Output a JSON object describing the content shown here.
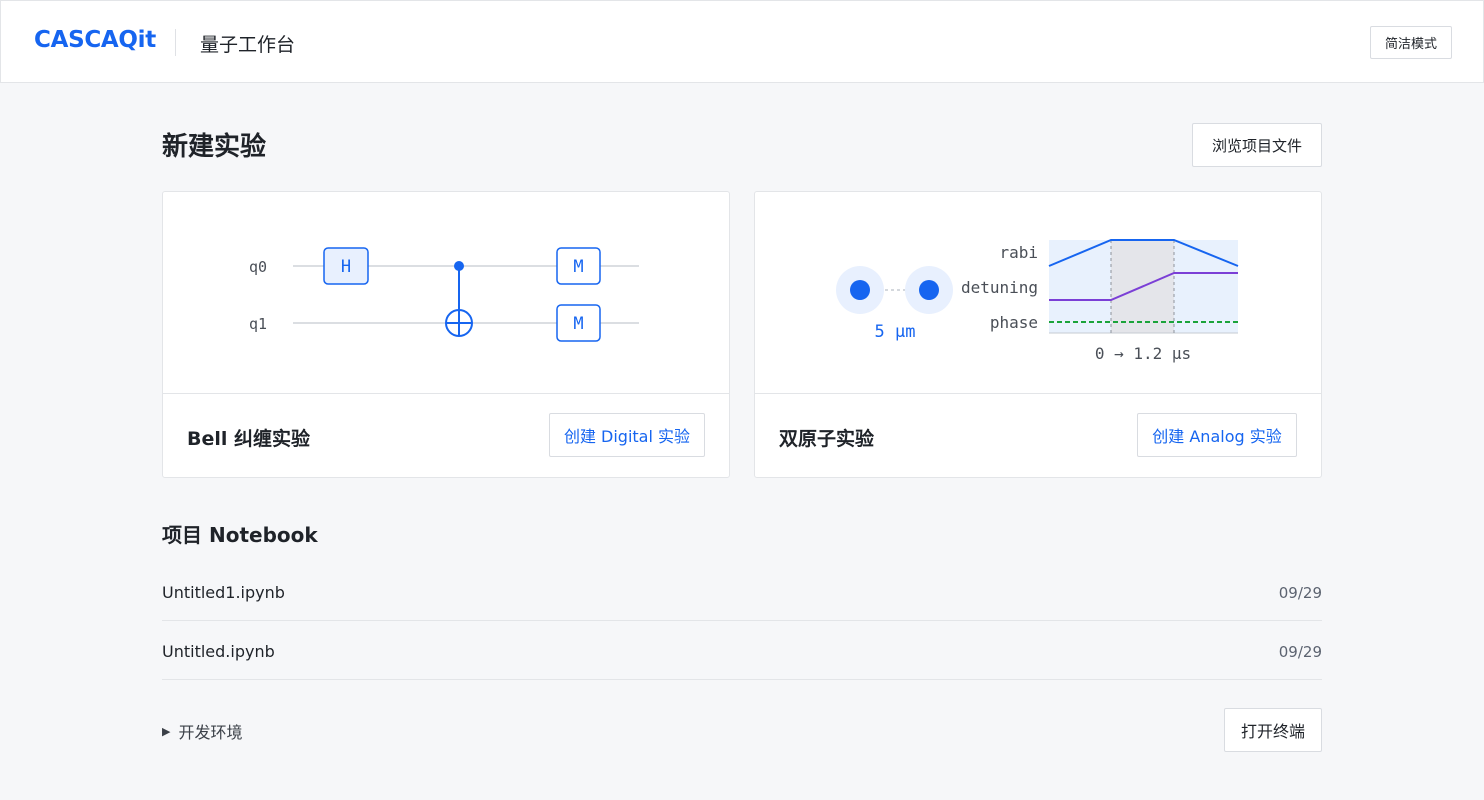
{
  "header": {
    "brand": "CASCAQit",
    "app_title": "量子工作台",
    "simple_mode_label": "简洁模式"
  },
  "main": {
    "title": "新建实验",
    "browse_label": "浏览项目文件"
  },
  "cards": [
    {
      "title": "Bell 纠缠实验",
      "button_label": "创建 Digital 实验",
      "circuit": {
        "qubits": [
          "q0",
          "q1"
        ],
        "gate_h": "H",
        "gate_m": "M"
      }
    },
    {
      "title": "双原子实验",
      "button_label": "创建 Analog 实验",
      "atoms": {
        "distance_label": "5 μm"
      },
      "waveform": {
        "labels": [
          "rabi",
          "detuning",
          "phase"
        ],
        "time_label": "0 → 1.2 μs"
      }
    }
  ],
  "notebooks": {
    "title": "项目 Notebook",
    "items": [
      {
        "name": "Untitled1.ipynb",
        "date": "09/29"
      },
      {
        "name": "Untitled.ipynb",
        "date": "09/29"
      }
    ]
  },
  "dev_env": {
    "label": "开发环境",
    "terminal_label": "打开终端"
  },
  "colors": {
    "accent": "#1665f0",
    "detuning": "#7b3fd6",
    "phase": "#1aa33a"
  }
}
